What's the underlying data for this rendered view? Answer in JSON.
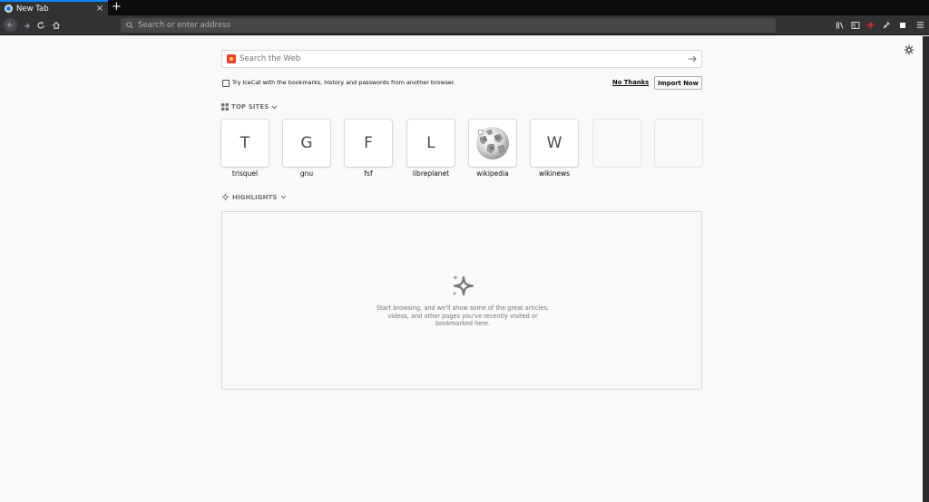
{
  "browser": {
    "tab_title": "New Tab",
    "new_tab_symbol": "+",
    "close_symbol": "×",
    "url_placeholder": "Search or enter address",
    "accent_color": "#0a84ff"
  },
  "toolbar_icons": [
    "back-icon",
    "forward-icon",
    "reload-icon",
    "home-icon",
    "library-icon",
    "sidebar-icon",
    "extension-icon",
    "extension-icon",
    "extension-icon",
    "menu-icon"
  ],
  "search": {
    "placeholder": "Search the Web",
    "engine_icon": "search-engine-logo-icon",
    "go_icon": "arrow-right-icon"
  },
  "import_banner": {
    "message": "Try IceCat with the bookmarks, history and passwords from another browser.",
    "no_thanks": "No Thanks",
    "import_now": "Import Now"
  },
  "top_sites": {
    "title": "TOP SITES",
    "tiles": [
      {
        "letter": "T",
        "label": "trisquel"
      },
      {
        "letter": "G",
        "label": "gnu"
      },
      {
        "letter": "F",
        "label": "fsf"
      },
      {
        "letter": "L",
        "label": "libreplanet"
      },
      {
        "letter": "",
        "label": "wikipedia",
        "icon": "wikipedia-globe-icon"
      },
      {
        "letter": "W",
        "label": "wikinews"
      },
      {
        "letter": "",
        "label": ""
      },
      {
        "letter": "",
        "label": ""
      }
    ]
  },
  "highlights": {
    "title": "HIGHLIGHTS",
    "empty_message": "Start browsing, and we'll show some of the great articles, videos, and other pages you've recently visited or bookmarked here."
  }
}
